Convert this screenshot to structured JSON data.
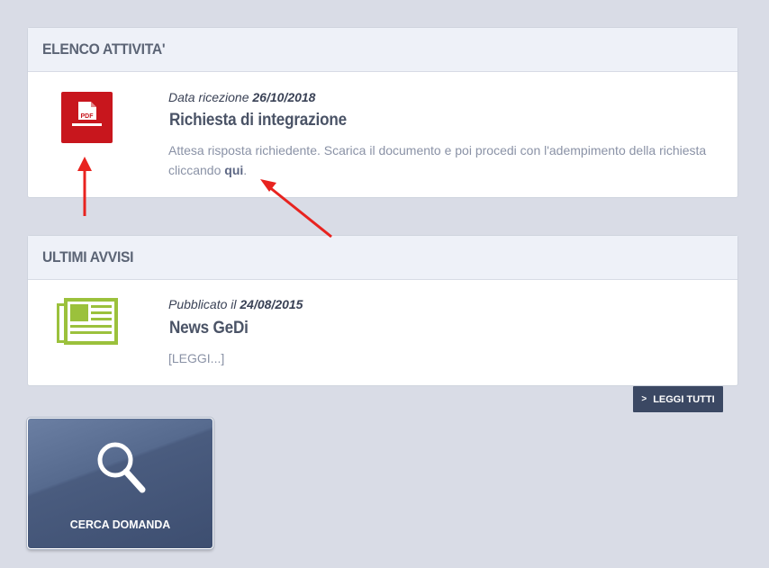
{
  "tasks_panel": {
    "title": "ELENCO ATTIVITA'",
    "item": {
      "icon": "pdf-icon",
      "icon_label": "PDF",
      "date_prefix": "Data ricezione",
      "date": "26/10/2018",
      "title": "Richiesta di integrazione",
      "description": "Attesa risposta richiedente. Scarica il documento e poi procedi con l'adempimento della richiesta cliccando",
      "link_text": "qui",
      "suffix": "."
    }
  },
  "news_panel": {
    "title": "ULTIMI AVVISI",
    "item": {
      "icon": "newspaper-icon",
      "date_prefix": "Pubblicato il",
      "date": "24/08/2015",
      "title": "News GeDi",
      "read_more": "[LEGGI...]"
    },
    "read_all_label": "LEGGI TUTTI"
  },
  "search_tile": {
    "icon": "search-icon",
    "label": "CERCA DOMANDA"
  },
  "colors": {
    "background": "#d9dce6",
    "pdf_red": "#c8161d",
    "news_green": "#9bc13c",
    "button_dark": "#3b4863",
    "annotation_arrow": "#e8231f"
  }
}
